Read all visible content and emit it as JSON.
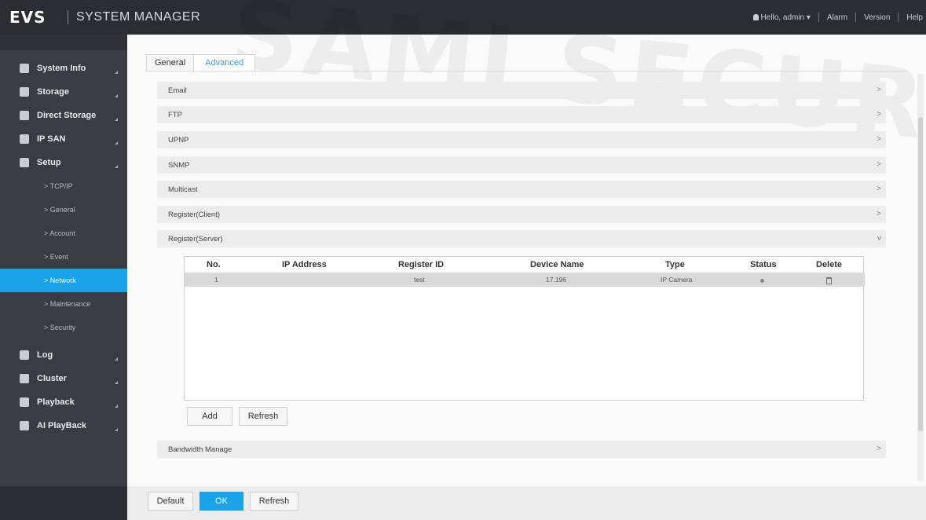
{
  "header": {
    "logo": "EVS",
    "title": "SYSTEM MANAGER",
    "user": "Hello, admin",
    "links": [
      "Alarm",
      "Version",
      "Help"
    ]
  },
  "sidebar": {
    "items": [
      {
        "label": "System Info",
        "icon": "info-icon"
      },
      {
        "label": "Storage",
        "icon": "storage-icon"
      },
      {
        "label": "Direct Storage",
        "icon": "direct-storage-icon"
      },
      {
        "label": "IP SAN",
        "icon": "ip-san-icon"
      },
      {
        "label": "Setup",
        "icon": "gear-icon"
      }
    ],
    "setup_sub": [
      "> TCP/IP",
      "> General",
      "> Account",
      "> Event",
      "> Network",
      "> Maintenance",
      "> Security"
    ],
    "active_sub": "> Network",
    "items_bottom": [
      {
        "label": "Log",
        "icon": "log-icon"
      },
      {
        "label": "Cluster",
        "icon": "cluster-icon"
      },
      {
        "label": "Playback",
        "icon": "playback-icon"
      },
      {
        "label": "AI PlayBack",
        "icon": "ai-playback-icon"
      }
    ]
  },
  "tabs": {
    "general": "General",
    "advanced": "Advanced"
  },
  "sections": [
    "Email",
    "FTP",
    "UPNP",
    "SNMP",
    "Multicast",
    "Register(Client)",
    "Register(Server)"
  ],
  "bandwidth": "Bandwidth Manage",
  "table": {
    "headers": {
      "no": "No.",
      "ip": "IP Address",
      "register_id": "Register ID",
      "device_name": "Device Name",
      "type": "Type",
      "status": "Status",
      "delete": "Delete"
    },
    "rows": [
      {
        "no": "1",
        "ip": "",
        "register_id": "test",
        "device_name": "17.196",
        "type": "IP Camera"
      }
    ]
  },
  "table_buttons": {
    "add": "Add",
    "refresh": "Refresh"
  },
  "footer_buttons": {
    "default": "Default",
    "ok": "OK",
    "refresh": "Refresh"
  },
  "watermark": "SAMI SECURITY",
  "colors": {
    "accent": "#1aa3e8",
    "sidebar": "#3a3c44",
    "topbar": "#2b2d33"
  }
}
